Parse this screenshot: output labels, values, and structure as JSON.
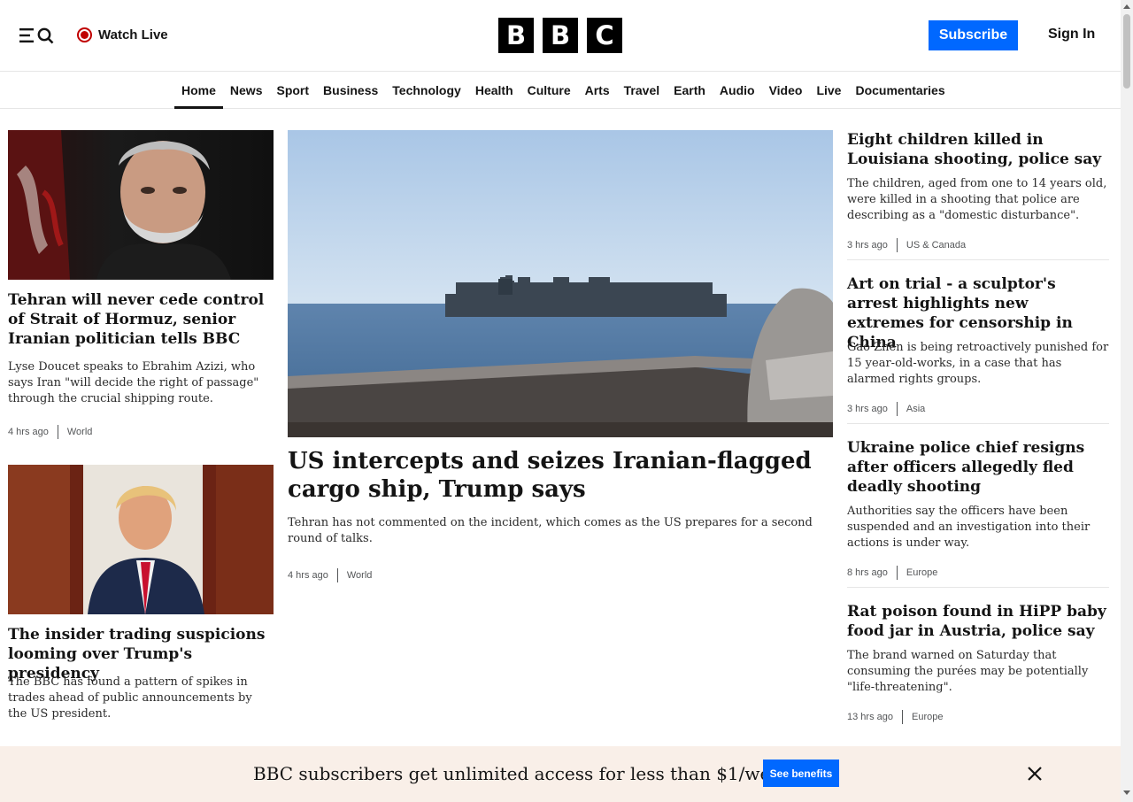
{
  "header": {
    "watch_live": "Watch Live",
    "logo_letters": [
      "B",
      "B",
      "C"
    ],
    "subscribe": "Subscribe",
    "sign_in": "Sign In"
  },
  "nav": {
    "items": [
      "Home",
      "News",
      "Sport",
      "Business",
      "Technology",
      "Health",
      "Culture",
      "Arts",
      "Travel",
      "Earth",
      "Audio",
      "Video",
      "Live",
      "Documentaries"
    ],
    "active": "Home"
  },
  "left": [
    {
      "headline": "Tehran will never cede control of Strait of Hormuz, senior Iranian politician tells BBC",
      "summary": "Lyse Doucet speaks to Ebrahim Azizi, who says Iran \"will decide the right of passage\" through the crucial shipping route.",
      "time": "4 hrs ago",
      "section": "World"
    },
    {
      "headline": "The insider trading suspicions looming over Trump's presidency",
      "summary": "The BBC has found a pattern of spikes in trades ahead of public announcements by the US president.",
      "time": "",
      "section": ""
    }
  ],
  "main": {
    "headline": "US intercepts and seizes Iranian-flagged cargo ship, Trump says",
    "summary": "Tehran has not commented on the incident, which comes as the US prepares for a second round of talks.",
    "time": "4 hrs ago",
    "section": "World"
  },
  "right": [
    {
      "headline": "Eight children killed in Louisiana shooting, police say",
      "summary": "The children, aged from one to 14 years old, were killed in a shooting that police are describing as a \"domestic disturbance\".",
      "time": "3 hrs ago",
      "section": "US & Canada"
    },
    {
      "headline": "Art on trial - a sculptor's arrest highlights new extremes for censorship in China",
      "summary": "Gao Zhen is being retroactively punished for 15 year-old-works, in a case that has alarmed rights groups.",
      "time": "3 hrs ago",
      "section": "Asia"
    },
    {
      "headline": "Ukraine police chief resigns after officers allegedly fled deadly shooting",
      "summary": "Authorities say the officers have been suspended and an investigation into their actions is under way.",
      "time": "8 hrs ago",
      "section": "Europe"
    },
    {
      "headline": "Rat poison found in HiPP baby food jar in Austria, police say",
      "summary": "The brand warned on Saturday that consuming the purées may be potentially \"life-threatening\".",
      "time": "13 hrs ago",
      "section": "Europe"
    }
  ],
  "banner": {
    "text": "BBC subscribers get unlimited access for less than $1/week",
    "button": "See benefits"
  },
  "colors": {
    "accent_blue": "#0068ff",
    "live_red": "#c00000",
    "banner_bg": "#f9efe8"
  },
  "icons": [
    "menu-icon",
    "search-icon",
    "live-indicator-icon",
    "close-icon"
  ]
}
